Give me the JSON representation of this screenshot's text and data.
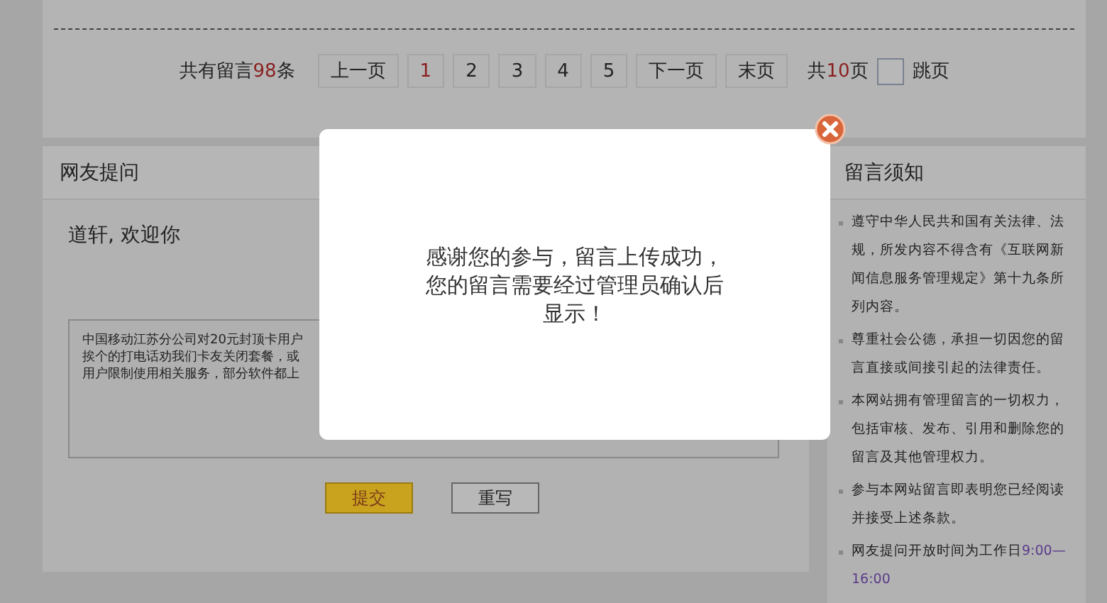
{
  "pager": {
    "total_prefix": "共有留言",
    "total_count": "98",
    "total_suffix": "条",
    "buttons": [
      {
        "label": "上一页",
        "selected": false
      },
      {
        "label": "1",
        "selected": true
      },
      {
        "label": "2",
        "selected": false
      },
      {
        "label": "3",
        "selected": false
      },
      {
        "label": "4",
        "selected": false
      },
      {
        "label": "5",
        "selected": false
      },
      {
        "label": "下一页",
        "selected": false
      },
      {
        "label": "末页",
        "selected": false
      }
    ],
    "pages_prefix": "共",
    "pages_count": "10",
    "pages_suffix": "页",
    "jump_label": "跳页"
  },
  "question_panel": {
    "title": "网友提问",
    "greeting": "道轩, 欢迎你",
    "message_lines": [
      "中国移动江苏分公司对20元封顶卡用户",
      "挨个的打电话劝我们卡友关闭套餐，或",
      "用户限制使用相关服务，部分软件都上"
    ],
    "submit": "提交",
    "reset": "重写"
  },
  "notice_panel": {
    "title": "留言须知",
    "items": [
      {
        "text": "遵守中华人民共和国有关法律、法规，所发内容不得含有《互联网新闻信息服务管理规定》第十九条所列内容。"
      },
      {
        "text": "尊重社会公德，承担一切因您的留言直接或间接引起的法律责任。"
      },
      {
        "text": "本网站拥有管理留言的一切权力，包括审核、发布、引用和删除您的留言及其他管理权力。"
      },
      {
        "text": "参与本网站留言即表明您已经阅读并接受上述条款。"
      },
      {
        "text": "网友提问开放时间为工作日",
        "highlight": "9:00—16:00"
      }
    ]
  },
  "dialog": {
    "message": "感谢您的参与，留言上传成功，您的留言需要经过管理员确认后显示！"
  }
}
